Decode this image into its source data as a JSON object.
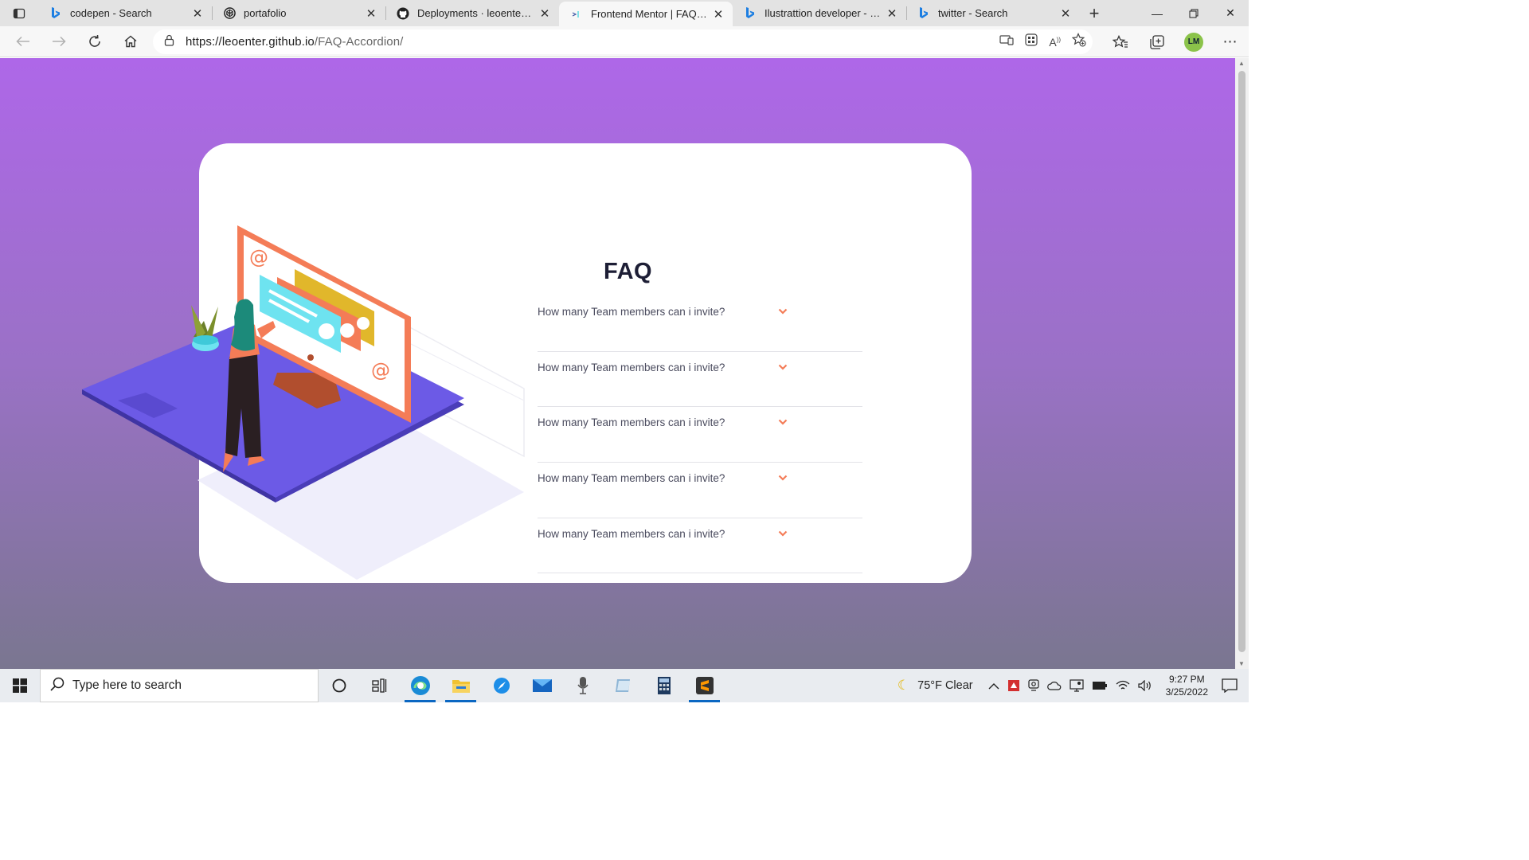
{
  "browser": {
    "tabs": [
      {
        "title": "codepen - Search",
        "icon": "bing-icon",
        "active": false
      },
      {
        "title": "portafolio",
        "icon": "codepen-icon",
        "active": false
      },
      {
        "title": "Deployments · leoenter/FAQ",
        "icon": "github-icon",
        "active": false
      },
      {
        "title": "Frontend Mentor | FAQ Accordion",
        "icon": "frontend-mentor-icon",
        "active": true
      },
      {
        "title": "Ilustrattion developer - Search",
        "icon": "bing-icon",
        "active": false
      },
      {
        "title": "twitter - Search",
        "icon": "bing-icon",
        "active": false
      }
    ],
    "url_host": "https://leoenter.github.io",
    "url_path": "/FAQ-Accordion/",
    "profile_initials": "LM"
  },
  "page": {
    "title": "FAQ",
    "questions": [
      "How many Team members can i invite?",
      "How many Team members can i invite?",
      "How many Team members can i invite?",
      "How many Team members can i invite?",
      "How many Team members can i invite?"
    ],
    "colors": {
      "background_top": "#ae67e8",
      "background_bottom": "#7a7690",
      "accent": "#f47c57",
      "title": "#1d1e35"
    }
  },
  "taskbar": {
    "search_placeholder": "Type here to search",
    "weather": "75°F  Clear",
    "time": "9:27 PM",
    "date": "3/25/2022"
  }
}
